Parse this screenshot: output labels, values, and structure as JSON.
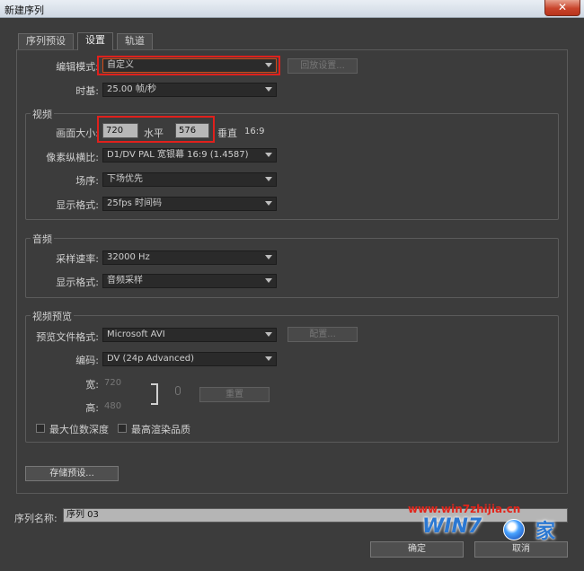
{
  "window": {
    "title": "新建序列",
    "close_glyph": "✕"
  },
  "tabs": [
    {
      "label": "序列预设"
    },
    {
      "label": "设置",
      "active": true
    },
    {
      "label": "轨道"
    }
  ],
  "settings": {
    "edit_mode": {
      "label": "编辑模式:",
      "value": "自定义"
    },
    "playback_settings_button": "回放设置...",
    "timebase": {
      "label": "时基:",
      "value": "25.00 帧/秒"
    }
  },
  "video": {
    "title": "视频",
    "frame_size": {
      "label": "画面大小:",
      "width": "720",
      "h_label": "水平",
      "height": "576",
      "v_label": "垂直",
      "ratio": "16:9"
    },
    "pixel_aspect": {
      "label": "像素纵横比:",
      "value": "D1/DV PAL 宽银幕 16:9 (1.4587)"
    },
    "fields": {
      "label": "场序:",
      "value": "下场优先"
    },
    "display_format": {
      "label": "显示格式:",
      "value": "25fps 时间码"
    }
  },
  "audio": {
    "title": "音频",
    "sample_rate": {
      "label": "采样速率:",
      "value": "32000 Hz"
    },
    "display_format": {
      "label": "显示格式:",
      "value": "音频采样"
    }
  },
  "video_preview": {
    "title": "视频预览",
    "file_format": {
      "label": "预览文件格式:",
      "value": "Microsoft AVI"
    },
    "configure_button": "配置...",
    "codec": {
      "label": "编码:",
      "value": "DV (24p Advanced)"
    },
    "width": {
      "label": "宽:",
      "value": "720"
    },
    "height": {
      "label": "高:",
      "value": "480"
    },
    "reset_button": "重置",
    "max_bit_depth": "最大位数深度",
    "max_render_quality": "最高渲染品质"
  },
  "save_preset_button": "存储预设...",
  "sequence_name": {
    "label": "序列名称:",
    "value": "序列 03"
  },
  "ok_button": "确定",
  "cancel_button": "取消",
  "watermark": {
    "url": "www.win7zhijia.cn",
    "logo": "WIN7",
    "logo_suffix": "家"
  },
  "colors": {
    "background": "#3c3c3c",
    "highlight_red": "#e0201c",
    "edit_mode_border": "#d34a17"
  }
}
